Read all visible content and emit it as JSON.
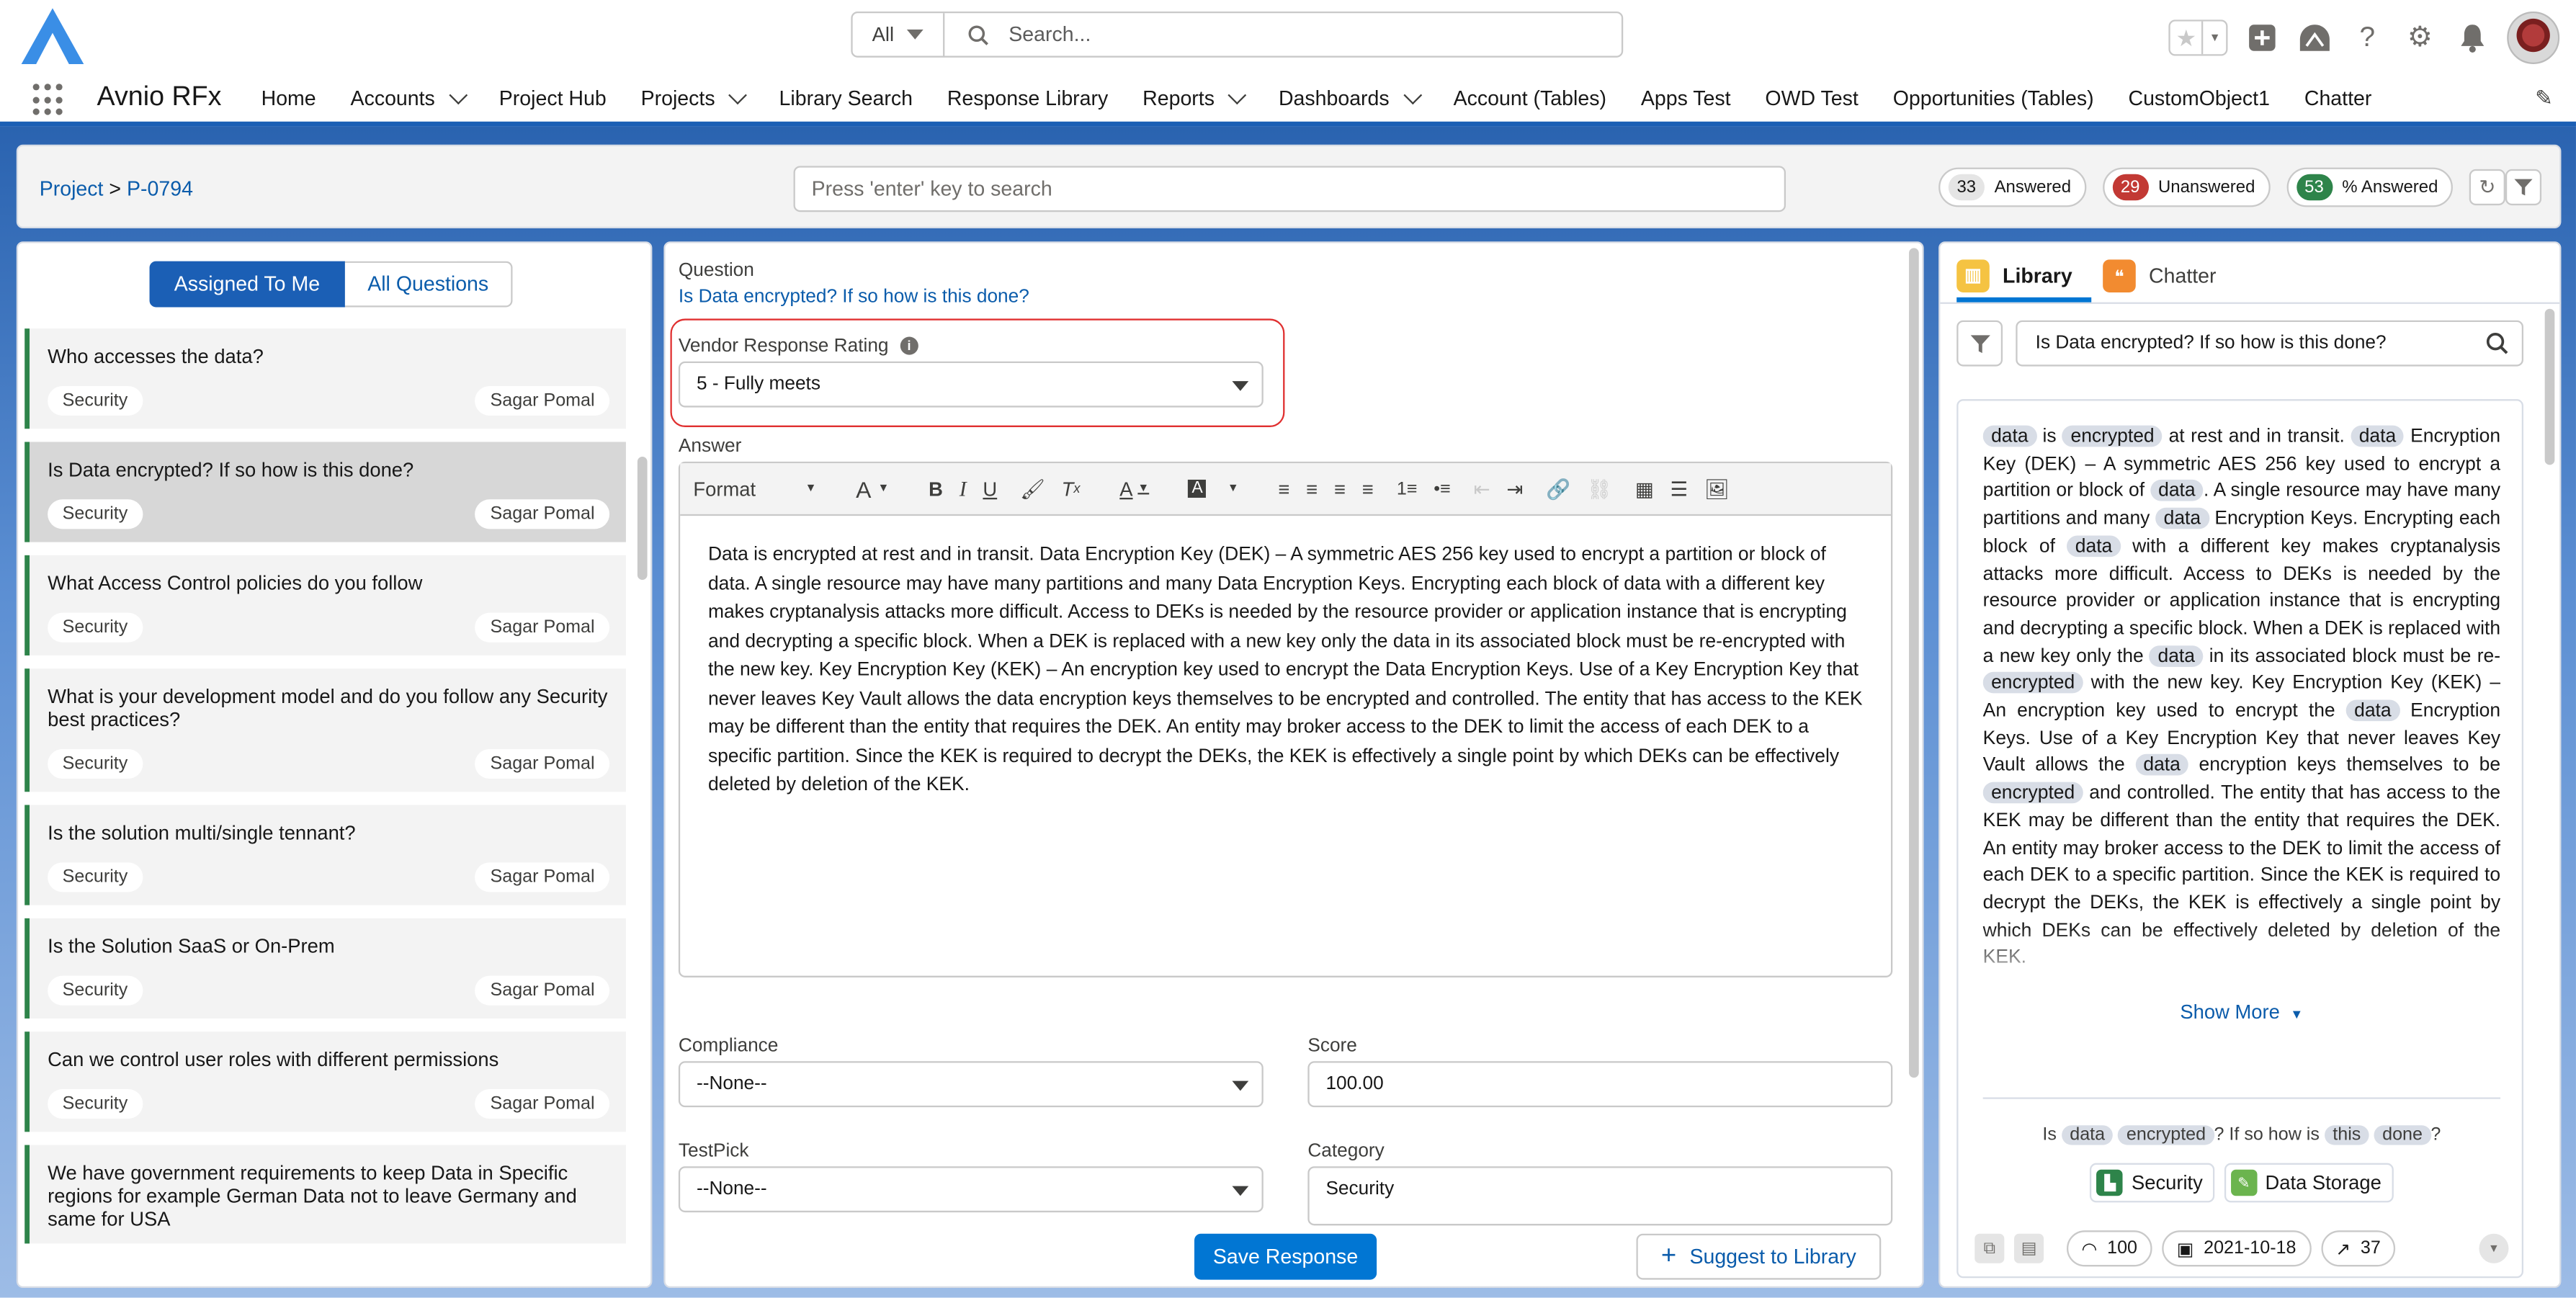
{
  "header": {
    "search_scope": "All",
    "search_placeholder": "Search..."
  },
  "nav": {
    "app_name": "Avnio RFx",
    "items": [
      {
        "label": "Home",
        "dropdown": false
      },
      {
        "label": "Accounts",
        "dropdown": true
      },
      {
        "label": "Project Hub",
        "dropdown": false
      },
      {
        "label": "Projects",
        "dropdown": true
      },
      {
        "label": "Library Search",
        "dropdown": false
      },
      {
        "label": "Response Library",
        "dropdown": false
      },
      {
        "label": "Reports",
        "dropdown": true
      },
      {
        "label": "Dashboards",
        "dropdown": true
      },
      {
        "label": "Account (Tables)",
        "dropdown": false
      },
      {
        "label": "Apps Test",
        "dropdown": false
      },
      {
        "label": "OWD Test",
        "dropdown": false
      },
      {
        "label": "Opportunities (Tables)",
        "dropdown": false
      },
      {
        "label": "CustomObject1",
        "dropdown": false
      },
      {
        "label": "Chatter",
        "dropdown": false
      }
    ]
  },
  "toolbar": {
    "breadcrumb_root": "Project",
    "breadcrumb_sep": ">",
    "breadcrumb_current": "P-0794",
    "search_placeholder": "Press 'enter' key to search",
    "answered_count": "33",
    "answered_label": "Answered",
    "unanswered_count": "29",
    "unanswered_label": "Unanswered",
    "percent_count": "53",
    "percent_label": "% Answered"
  },
  "left": {
    "toggle_assigned": "Assigned To Me",
    "toggle_all": "All Questions",
    "questions": [
      {
        "text": "Who accesses the data?",
        "category": "Security",
        "owner": "Sagar Pomal"
      },
      {
        "text": "Is Data encrypted? If so how is this done?",
        "category": "Security",
        "owner": "Sagar Pomal"
      },
      {
        "text": "What Access Control policies do you follow",
        "category": "Security",
        "owner": "Sagar Pomal"
      },
      {
        "text": "What is your development model and do you follow any Security best practices?",
        "category": "Security",
        "owner": "Sagar Pomal"
      },
      {
        "text": "Is the solution multi/single tennant?",
        "category": "Security",
        "owner": "Sagar Pomal"
      },
      {
        "text": "Is the Solution SaaS or On-Prem",
        "category": "Security",
        "owner": "Sagar Pomal"
      },
      {
        "text": "Can we control user roles with different permissions",
        "category": "Security",
        "owner": "Sagar Pomal"
      },
      {
        "text": "We have government requirements to keep Data in Specific regions for example German Data not to leave Germany and same for USA",
        "category": "",
        "owner": ""
      }
    ]
  },
  "center": {
    "question_label": "Question",
    "question_text": "Is Data encrypted? If so how is this done?",
    "rating_label": "Vendor Response Rating",
    "rating_value": "5 - Fully meets",
    "answer_label": "Answer",
    "format_label": "Format",
    "answer_text": "Data is encrypted at rest and in transit. Data Encryption Key (DEK) – A symmetric AES 256 key used to encrypt a partition or block of data. A single resource may have many partitions and many Data Encryption Keys. Encrypting each block of data with a different key makes cryptanalysis attacks more difficult. Access to DEKs is needed by the resource provider or application instance that is encrypting and decrypting a specific block. When a DEK is replaced with a new key only the data in its associated block must be re-encrypted with the new key. Key Encryption Key (KEK) – An encryption key used to encrypt the Data Encryption Keys. Use of a Key Encryption Key that never leaves Key Vault allows the data encryption keys themselves to be encrypted and controlled. The entity that has access to the KEK may be different than the entity that requires the DEK. An entity may broker access to the DEK to limit the access of each DEK to a specific partition. Since the KEK is required to decrypt the DEKs, the KEK is effectively a single point by which DEKs can be effectively deleted by deletion of the KEK.",
    "compliance_label": "Compliance",
    "compliance_value": "--None--",
    "score_label": "Score",
    "score_value": "100.00",
    "testpick_label": "TestPick",
    "testpick_value": "--None--",
    "category_label": "Category",
    "category_value": "Security",
    "save_button": "Save Response",
    "suggest_button": "Suggest to Library"
  },
  "right": {
    "tab_library": "Library",
    "tab_chatter": "Chatter",
    "search_value": "Is Data encrypted? If so how is this done?",
    "result_segments": [
      {
        "t": "data",
        "m": true
      },
      {
        "t": " is ",
        "m": false
      },
      {
        "t": "encrypted",
        "m": true
      },
      {
        "t": " at rest and in transit. ",
        "m": false
      },
      {
        "t": "data",
        "m": true
      },
      {
        "t": " Encryption Key (DEK) – A symmetric AES 256 key used to encrypt a partition or block of ",
        "m": false
      },
      {
        "t": "data",
        "m": true
      },
      {
        "t": ". A single resource may have many partitions and many ",
        "m": false
      },
      {
        "t": "data",
        "m": true
      },
      {
        "t": " Encryption Keys. Encrypting each block of ",
        "m": false
      },
      {
        "t": "data",
        "m": true
      },
      {
        "t": " with a different key makes cryptanalysis attacks more difficult. Access to DEKs is needed by the resource provider or application instance that is encrypting and decrypting a specific block. When a DEK is replaced with a new key only the ",
        "m": false
      },
      {
        "t": "data",
        "m": true
      },
      {
        "t": " in its associated block must be re-",
        "m": false
      },
      {
        "t": "encrypted",
        "m": true
      },
      {
        "t": " with the new key. Key Encryption Key (KEK) – An encryption key used to encrypt the ",
        "m": false
      },
      {
        "t": "data",
        "m": true
      },
      {
        "t": " Encryption Keys. Use of a Key Encryption Key that never leaves Key Vault allows the ",
        "m": false
      },
      {
        "t": "data",
        "m": true
      },
      {
        "t": " encryption keys themselves to be ",
        "m": false
      },
      {
        "t": "encrypted",
        "m": true
      },
      {
        "t": " and controlled. The entity that has access to the KEK may be different than the entity that requires the DEK. An entity may broker access to the DEK to limit the access of each DEK to a specific partition. Since the KEK is required to decrypt the DEKs, the KEK is effectively a single point by which DEKs can be effectively deleted by deletion of the KEK.",
        "m": false
      }
    ],
    "show_more": "Show More",
    "match_segments": [
      {
        "t": "Is ",
        "m": false
      },
      {
        "t": "data",
        "m": true
      },
      {
        "t": " ",
        "m": false
      },
      {
        "t": "encrypted",
        "m": true
      },
      {
        "t": "? If so how is ",
        "m": false
      },
      {
        "t": "this",
        "m": true
      },
      {
        "t": " ",
        "m": false
      },
      {
        "t": "done",
        "m": true
      },
      {
        "t": "?",
        "m": false
      }
    ],
    "categories": [
      {
        "label": "Security",
        "color": "#2e844a"
      },
      {
        "label": "Data Storage",
        "color": "#6bb44e"
      }
    ],
    "footer_score": "100",
    "footer_date": "2021-10-18",
    "footer_uses": "37"
  },
  "colors": {
    "brand_blue": "#1b5fb5",
    "button_blue": "#0176d3",
    "answered_badge": "#e5e5e5",
    "unanswered_badge": "#c23934",
    "percent_badge": "#2e844a",
    "highlight_border": "#e03030"
  }
}
